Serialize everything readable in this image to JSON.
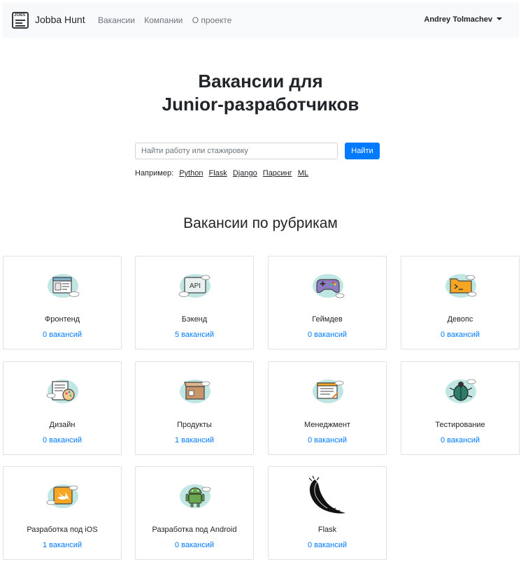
{
  "nav": {
    "brand": "Jobba Hunt",
    "logo_text": "JOBS",
    "links": [
      "Вакансии",
      "Компании",
      "О проекте"
    ],
    "user": "Andrey Tolmachev"
  },
  "hero": {
    "title_line1": "Вакансии для",
    "title_line2": "Junior-разработчиков"
  },
  "search": {
    "placeholder": "Найти работу или стажировку",
    "value": "",
    "button": "Найти",
    "examples_label": "Например:",
    "examples": [
      "Python",
      "Flask",
      "Django",
      "Парсинг",
      "ML"
    ]
  },
  "categories_title": "Вакансии по рубрикам",
  "categories": [
    {
      "title": "Фронтенд",
      "count": "0 вакансий",
      "icon": "frontend-icon"
    },
    {
      "title": "Бэкенд",
      "count": "5 вакансий",
      "icon": "backend-api-icon"
    },
    {
      "title": "Геймдев",
      "count": "0 вакансий",
      "icon": "gamepad-icon"
    },
    {
      "title": "Девопс",
      "count": "0 вакансий",
      "icon": "terminal-folder-icon"
    },
    {
      "title": "Дизайн",
      "count": "0 вакансий",
      "icon": "design-palette-icon"
    },
    {
      "title": "Продукты",
      "count": "1 вакансий",
      "icon": "product-box-icon"
    },
    {
      "title": "Менеджмент",
      "count": "0 вакансий",
      "icon": "management-list-icon"
    },
    {
      "title": "Тестирование",
      "count": "0 вакансий",
      "icon": "bug-icon"
    },
    {
      "title": "Разработка под iOS",
      "count": "1 вакансий",
      "icon": "swift-icon"
    },
    {
      "title": "Разработка под Android",
      "count": "0 вакансий",
      "icon": "android-icon"
    },
    {
      "title": "Flask",
      "count": "0 вакансий",
      "icon": "flask-logo-icon"
    }
  ],
  "colors": {
    "accent": "#007bff",
    "navbar_bg": "#f8f9fa",
    "icon_blob": "#bfe6e3",
    "icon_orange": "#f6a623"
  }
}
